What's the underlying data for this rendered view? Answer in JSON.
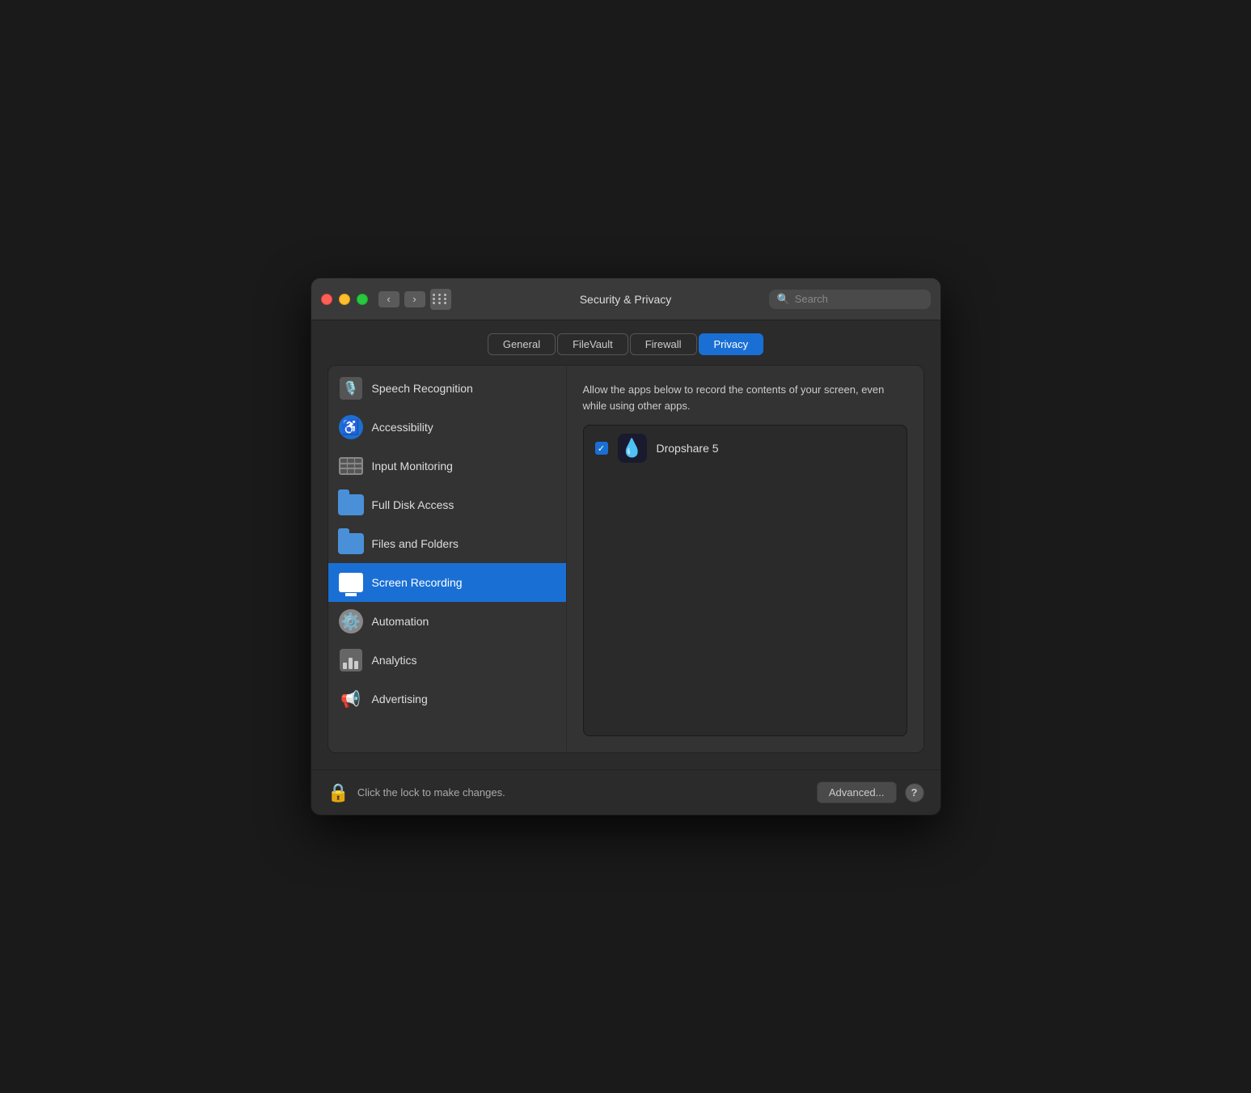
{
  "window": {
    "title": "Security & Privacy"
  },
  "titlebar": {
    "back_label": "‹",
    "forward_label": "›"
  },
  "search": {
    "placeholder": "Search"
  },
  "tabs": [
    {
      "id": "general",
      "label": "General"
    },
    {
      "id": "filevault",
      "label": "FileVault"
    },
    {
      "id": "firewall",
      "label": "Firewall"
    },
    {
      "id": "privacy",
      "label": "Privacy"
    }
  ],
  "active_tab": "privacy",
  "sidebar": {
    "items": [
      {
        "id": "speech-recognition",
        "label": "Speech Recognition",
        "icon": "mic"
      },
      {
        "id": "accessibility",
        "label": "Accessibility",
        "icon": "accessibility"
      },
      {
        "id": "input-monitoring",
        "label": "Input Monitoring",
        "icon": "keyboard"
      },
      {
        "id": "full-disk-access",
        "label": "Full Disk Access",
        "icon": "folder"
      },
      {
        "id": "files-and-folders",
        "label": "Files and Folders",
        "icon": "folder"
      },
      {
        "id": "screen-recording",
        "label": "Screen Recording",
        "icon": "monitor",
        "active": true
      },
      {
        "id": "automation",
        "label": "Automation",
        "icon": "gear"
      },
      {
        "id": "analytics",
        "label": "Analytics",
        "icon": "chart"
      },
      {
        "id": "advertising",
        "label": "Advertising",
        "icon": "megaphone"
      }
    ]
  },
  "content": {
    "description": "Allow the apps below to record the contents of your screen, even while using other apps.",
    "apps": [
      {
        "id": "dropshare",
        "name": "Dropshare 5",
        "checked": true
      }
    ]
  },
  "bottom": {
    "lock_text": "Click the lock to make changes.",
    "advanced_label": "Advanced...",
    "help_label": "?"
  }
}
